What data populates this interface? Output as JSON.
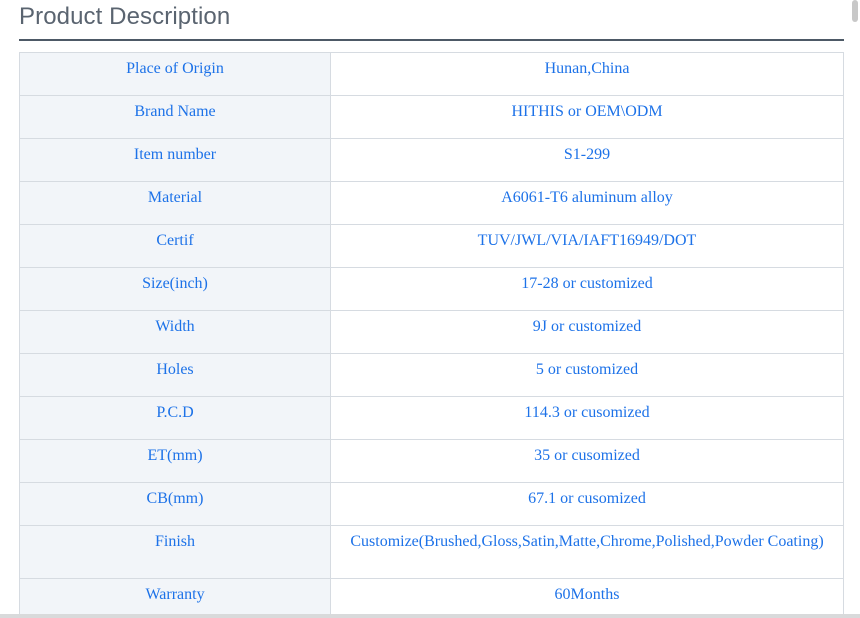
{
  "section": {
    "title": "Product Description"
  },
  "specs": [
    {
      "label": "Place of Origin",
      "value": "Hunan,China"
    },
    {
      "label": "Brand Name",
      "value": "HITHIS or OEM\\ODM"
    },
    {
      "label": "Item number",
      "value": "S1-299"
    },
    {
      "label": "Material",
      "value": "A6061-T6 aluminum  alloy"
    },
    {
      "label": "Certif",
      "value": "TUV/JWL/VIA/IAFT16949/DOT"
    },
    {
      "label": "Size(inch)",
      "value": "17-28 or customized"
    },
    {
      "label": "Width",
      "value": "9J or customized"
    },
    {
      "label": "Holes",
      "value": "5  or customized"
    },
    {
      "label": "P.C.D",
      "value": "114.3 or cusomized"
    },
    {
      "label": "ET(mm)",
      "value": "35 or cusomized"
    },
    {
      "label": "CB(mm)",
      "value": "67.1 or cusomized"
    },
    {
      "label": "Finish",
      "value": "Customize(Brushed,Gloss,Satin,Matte,Chrome,Polished,Powder Coating)"
    },
    {
      "label": "Warranty",
      "value": "60Months"
    }
  ],
  "colors": {
    "text_accent": "#1d72e8",
    "label_bg": "#f2f5f9",
    "heading": "#5a6470"
  }
}
